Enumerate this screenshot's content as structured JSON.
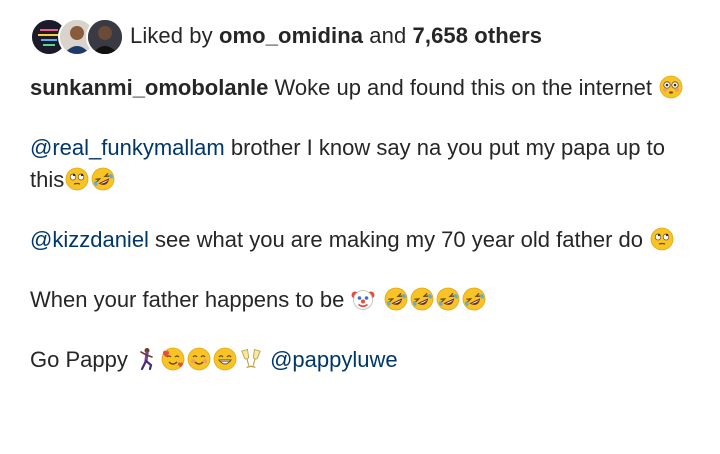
{
  "likes": {
    "prefix": "Liked by ",
    "first_user": "omo_omidina",
    "conj": " and ",
    "others": "7,658 others"
  },
  "caption": {
    "author": "sunkanmi_omobolanle",
    "p1_text": " Woke up and found this on the internet ",
    "p1_emoji": "flushed-face",
    "p2_mention": "@real_funkymallam",
    "p2_text": " brother I know say na you put my papa up to this",
    "p2_emojis": [
      "eye-roll-face",
      "rolling-laughing-face"
    ],
    "p3_mention": "@kizzdaniel",
    "p3_text": " see what you are making my 70 year old father do ",
    "p3_emoji": "eye-roll-face",
    "p4_text": "When your father happens to be ",
    "p4_emojis": [
      "clown-face",
      "rolling-laughing-face",
      "rolling-laughing-face",
      "rolling-laughing-face",
      "rolling-laughing-face"
    ],
    "p5_text": "Go Pappy ",
    "p5_emojis": [
      "dancing-man",
      "smiling-face-with-hearts",
      "smiling-face",
      "grinning-face",
      "clinking-glasses"
    ],
    "p5_mention": "@pappyluwe"
  },
  "colors": {
    "text": "#262626",
    "mention": "#00376b",
    "emoji_yellow": "#f7c325"
  }
}
